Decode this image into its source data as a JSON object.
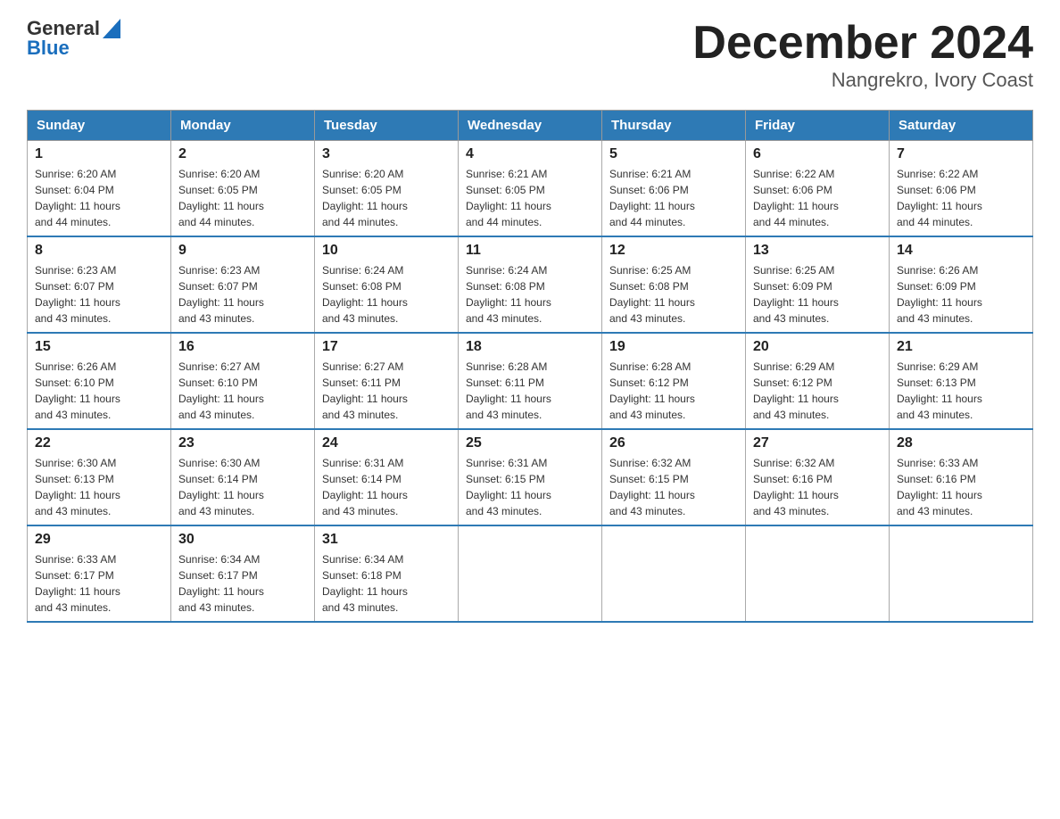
{
  "logo": {
    "general": "General",
    "blue": "Blue"
  },
  "title": "December 2024",
  "subtitle": "Nangrekro, Ivory Coast",
  "days_of_week": [
    "Sunday",
    "Monday",
    "Tuesday",
    "Wednesday",
    "Thursday",
    "Friday",
    "Saturday"
  ],
  "weeks": [
    [
      {
        "day": "1",
        "sunrise": "6:20 AM",
        "sunset": "6:04 PM",
        "daylight": "11 hours and 44 minutes."
      },
      {
        "day": "2",
        "sunrise": "6:20 AM",
        "sunset": "6:05 PM",
        "daylight": "11 hours and 44 minutes."
      },
      {
        "day": "3",
        "sunrise": "6:20 AM",
        "sunset": "6:05 PM",
        "daylight": "11 hours and 44 minutes."
      },
      {
        "day": "4",
        "sunrise": "6:21 AM",
        "sunset": "6:05 PM",
        "daylight": "11 hours and 44 minutes."
      },
      {
        "day": "5",
        "sunrise": "6:21 AM",
        "sunset": "6:06 PM",
        "daylight": "11 hours and 44 minutes."
      },
      {
        "day": "6",
        "sunrise": "6:22 AM",
        "sunset": "6:06 PM",
        "daylight": "11 hours and 44 minutes."
      },
      {
        "day": "7",
        "sunrise": "6:22 AM",
        "sunset": "6:06 PM",
        "daylight": "11 hours and 44 minutes."
      }
    ],
    [
      {
        "day": "8",
        "sunrise": "6:23 AM",
        "sunset": "6:07 PM",
        "daylight": "11 hours and 43 minutes."
      },
      {
        "day": "9",
        "sunrise": "6:23 AM",
        "sunset": "6:07 PM",
        "daylight": "11 hours and 43 minutes."
      },
      {
        "day": "10",
        "sunrise": "6:24 AM",
        "sunset": "6:08 PM",
        "daylight": "11 hours and 43 minutes."
      },
      {
        "day": "11",
        "sunrise": "6:24 AM",
        "sunset": "6:08 PM",
        "daylight": "11 hours and 43 minutes."
      },
      {
        "day": "12",
        "sunrise": "6:25 AM",
        "sunset": "6:08 PM",
        "daylight": "11 hours and 43 minutes."
      },
      {
        "day": "13",
        "sunrise": "6:25 AM",
        "sunset": "6:09 PM",
        "daylight": "11 hours and 43 minutes."
      },
      {
        "day": "14",
        "sunrise": "6:26 AM",
        "sunset": "6:09 PM",
        "daylight": "11 hours and 43 minutes."
      }
    ],
    [
      {
        "day": "15",
        "sunrise": "6:26 AM",
        "sunset": "6:10 PM",
        "daylight": "11 hours and 43 minutes."
      },
      {
        "day": "16",
        "sunrise": "6:27 AM",
        "sunset": "6:10 PM",
        "daylight": "11 hours and 43 minutes."
      },
      {
        "day": "17",
        "sunrise": "6:27 AM",
        "sunset": "6:11 PM",
        "daylight": "11 hours and 43 minutes."
      },
      {
        "day": "18",
        "sunrise": "6:28 AM",
        "sunset": "6:11 PM",
        "daylight": "11 hours and 43 minutes."
      },
      {
        "day": "19",
        "sunrise": "6:28 AM",
        "sunset": "6:12 PM",
        "daylight": "11 hours and 43 minutes."
      },
      {
        "day": "20",
        "sunrise": "6:29 AM",
        "sunset": "6:12 PM",
        "daylight": "11 hours and 43 minutes."
      },
      {
        "day": "21",
        "sunrise": "6:29 AM",
        "sunset": "6:13 PM",
        "daylight": "11 hours and 43 minutes."
      }
    ],
    [
      {
        "day": "22",
        "sunrise": "6:30 AM",
        "sunset": "6:13 PM",
        "daylight": "11 hours and 43 minutes."
      },
      {
        "day": "23",
        "sunrise": "6:30 AM",
        "sunset": "6:14 PM",
        "daylight": "11 hours and 43 minutes."
      },
      {
        "day": "24",
        "sunrise": "6:31 AM",
        "sunset": "6:14 PM",
        "daylight": "11 hours and 43 minutes."
      },
      {
        "day": "25",
        "sunrise": "6:31 AM",
        "sunset": "6:15 PM",
        "daylight": "11 hours and 43 minutes."
      },
      {
        "day": "26",
        "sunrise": "6:32 AM",
        "sunset": "6:15 PM",
        "daylight": "11 hours and 43 minutes."
      },
      {
        "day": "27",
        "sunrise": "6:32 AM",
        "sunset": "6:16 PM",
        "daylight": "11 hours and 43 minutes."
      },
      {
        "day": "28",
        "sunrise": "6:33 AM",
        "sunset": "6:16 PM",
        "daylight": "11 hours and 43 minutes."
      }
    ],
    [
      {
        "day": "29",
        "sunrise": "6:33 AM",
        "sunset": "6:17 PM",
        "daylight": "11 hours and 43 minutes."
      },
      {
        "day": "30",
        "sunrise": "6:34 AM",
        "sunset": "6:17 PM",
        "daylight": "11 hours and 43 minutes."
      },
      {
        "day": "31",
        "sunrise": "6:34 AM",
        "sunset": "6:18 PM",
        "daylight": "11 hours and 43 minutes."
      },
      null,
      null,
      null,
      null
    ]
  ],
  "labels": {
    "sunrise": "Sunrise:",
    "sunset": "Sunset:",
    "daylight": "Daylight:"
  }
}
